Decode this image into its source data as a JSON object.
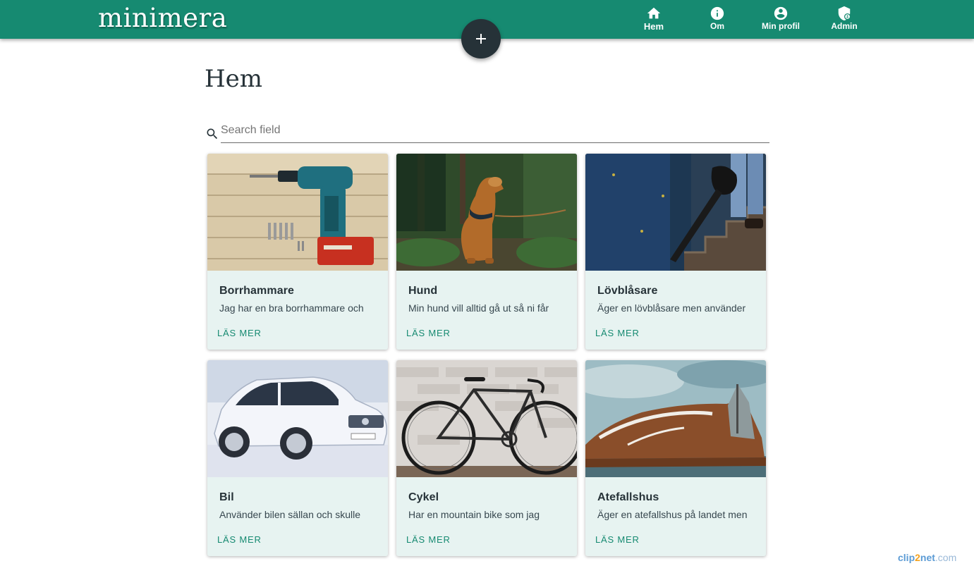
{
  "app": {
    "logo": "minimera"
  },
  "nav": {
    "items": [
      {
        "label": "Hem",
        "icon": "home-icon"
      },
      {
        "label": "Om",
        "icon": "info-icon"
      },
      {
        "label": "Min profil",
        "icon": "account-circle-icon"
      },
      {
        "label": "Admin",
        "icon": "admin-shield-icon"
      }
    ]
  },
  "fab": {
    "icon": "plus-icon"
  },
  "page": {
    "title": "Hem"
  },
  "search": {
    "placeholder": "Search field",
    "value": ""
  },
  "cards": [
    {
      "title": "Borrhammare",
      "text": "Jag har en bra borrhammare och",
      "button": "LÄS MER",
      "image": "drill"
    },
    {
      "title": "Hund",
      "text": "Min hund vill alltid gå ut så ni får",
      "button": "LÄS MER",
      "image": "dog"
    },
    {
      "title": "Lövblåsare",
      "text": "Äger en lövblåsare men använder",
      "button": "LÄS MER",
      "image": "leaf-blower"
    },
    {
      "title": "Bil",
      "text": "Använder bilen sällan och skulle",
      "button": "LÄS MER",
      "image": "car"
    },
    {
      "title": "Cykel",
      "text": "Har en mountain bike som jag",
      "button": "LÄS MER",
      "image": "bicycle"
    },
    {
      "title": "Atefallshus",
      "text": "Äger en atefallshus på landet men",
      "button": "LÄS MER",
      "image": "cabin"
    }
  ],
  "watermark": {
    "part1": "clip",
    "part2": "2",
    "part3": "net",
    "part4": ".com"
  },
  "colors": {
    "primary": "#168a71",
    "fab": "#263238",
    "card_bg": "#e7f3f1",
    "accent_text": "#168a71"
  }
}
